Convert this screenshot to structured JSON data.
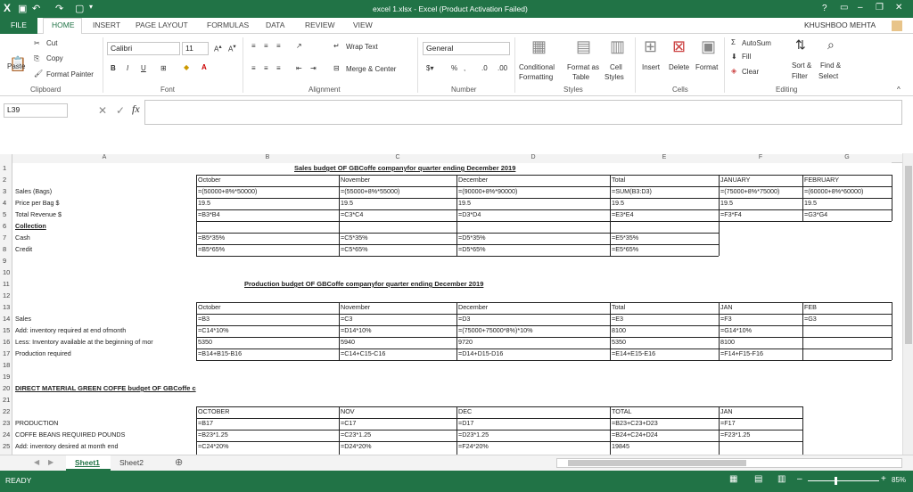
{
  "window": {
    "title": "excel 1.xlsx - Excel (Product Activation Failed)",
    "help": "?",
    "user": "KHUSHBOO MEHTA"
  },
  "tabs": [
    "FILE",
    "HOME",
    "INSERT",
    "PAGE LAYOUT",
    "FORMULAS",
    "DATA",
    "REVIEW",
    "VIEW"
  ],
  "ribbon": {
    "clipboard": {
      "cut": "Cut",
      "copy": "Copy",
      "format_painter": "Format Painter",
      "paste": "Paste",
      "group": "Clipboard"
    },
    "font": {
      "name": "Calibri",
      "size": "11",
      "group": "Font",
      "bold": "B",
      "italic": "I",
      "underline": "U"
    },
    "alignment": {
      "wrap": "Wrap Text",
      "merge": "Merge & Center",
      "group": "Alignment"
    },
    "number": {
      "format": "General",
      "group": "Number",
      "percent": "%",
      "comma": ","
    },
    "styles": {
      "conditional": "Conditional",
      "formatting": "Formatting",
      "format_as": "Format as",
      "table": "Table",
      "cell": "Cell",
      "cell_styles": "Styles",
      "group": "Styles"
    },
    "cells": {
      "insert": "Insert",
      "delete": "Delete",
      "format": "Format",
      "group": "Cells"
    },
    "editing": {
      "autosum": "AutoSum",
      "fill": "Fill",
      "clear": "Clear",
      "sort": "Sort &",
      "filter": "Filter",
      "find": "Find &",
      "select": "Select",
      "group": "Editing"
    }
  },
  "formula_bar": {
    "name_box": "L39",
    "fx": "fx",
    "content": ""
  },
  "columns": [
    "A",
    "B",
    "C",
    "D",
    "E",
    "F",
    "G"
  ],
  "rows": [
    "1",
    "2",
    "3",
    "4",
    "5",
    "6",
    "7",
    "8",
    "9",
    "10",
    "11",
    "12",
    "13",
    "14",
    "15",
    "16",
    "17",
    "18",
    "19",
    "20",
    "21",
    "22",
    "23",
    "24",
    "25"
  ],
  "cells": {
    "t1": "Sales budget OF GBCoffe companyfor quarter ending December 2019",
    "r2b": "October",
    "r2c": "November",
    "r2d": "December",
    "r2e": "Total",
    "r2f": "JANUARY",
    "r2g": "FEBRUARY",
    "r3a": "Sales (Bags)",
    "r3b": "=(50000+8%*50000)",
    "r3c": "=(55000+8%*55000)",
    "r3d": "=(90000+8%*90000)",
    "r3e": "=SUM(B3:D3)",
    "r3f": "=(75000+8%*75000)",
    "r3g": "=(60000+8%*60000)",
    "r4a": "Price per Bag $",
    "r4b": "19.5",
    "r4c": "19.5",
    "r4d": "19.5",
    "r4e": "19.5",
    "r4f": "19.5",
    "r4g": "19.5",
    "r5a": "Total Revenue $",
    "r5b": "=B3*B4",
    "r5c": "=C3*C4",
    "r5d": "=D3*D4",
    "r5e": "=E3*E4",
    "r5f": "=F3*F4",
    "r5g": "=G3*G4",
    "r6a": "Collection",
    "r7a": "Cash",
    "r7b": "=B5*35%",
    "r7c": "=C5*35%",
    "r7d": "=D5*35%",
    "r7e": "=E5*35%",
    "r8a": "Credit",
    "r8b": "=B5*65%",
    "r8c": "=C5*65%",
    "r8d": "=D5*65%",
    "r8e": "=E5*65%",
    "t11": "Production budget OF GBCoffe companyfor quarter ending December 2019",
    "r13b": "October",
    "r13c": "November",
    "r13d": "December",
    "r13e": "Total",
    "r13f": "JAN",
    "r13g": "FEB",
    "r14a": "Sales",
    "r14b": "=B3",
    "r14c": "=C3",
    "r14d": "=D3",
    "r14e": "=E3",
    "r14f": "=F3",
    "r14g": "=G3",
    "r15a": "Add: inventory required at end ofmonth",
    "r15b": "=C14*10%",
    "r15c": "=D14*10%",
    "r15d": "=(75000+75000*8%)*10%",
    "r15e": "8100",
    "r15f": "=G14*10%",
    "r16a": "Less: Inventory available at the beginning of mor",
    "r16b": "5350",
    "r16c": "5940",
    "r16d": "9720",
    "r16e": "5350",
    "r16f": "8100",
    "r17a": "Production required",
    "r17b": "=B14+B15-B16",
    "r17c": "=C14+C15-C16",
    "r17d": "=D14+D15-D16",
    "r17e": "=E14+E15-E16",
    "r17f": "=F14+F15-F16",
    "t20": "DIRECT MATERIAL GREEN COFFE budget OF GBCoffe c",
    "r22b": "OCTOBER",
    "r22c": "NOV",
    "r22d": "DEC",
    "r22e": "TOTAL",
    "r22f": "JAN",
    "r23a": "PRODUCTION",
    "r23b": "=B17",
    "r23c": "=C17",
    "r23d": "=D17",
    "r23e": "=B23+C23+D23",
    "r23f": "=F17",
    "r24a": "COFFE BEANS REQUIRED POUNDS",
    "r24b": "=B23*1.25",
    "r24c": "=C23*1.25",
    "r24d": "=D23*1.25",
    "r24e": "=B24+C24+D24",
    "r24f": "=F23*1.25",
    "r25a": "Add: inventory desired at month end",
    "r25b": "=C24*20%",
    "r25c": "=D24*20%",
    "r25d": "=F24*20%",
    "r25e": "19845"
  },
  "sheets": [
    "Sheet1",
    "Sheet2"
  ],
  "status": {
    "ready": "READY",
    "zoom": "85%"
  }
}
